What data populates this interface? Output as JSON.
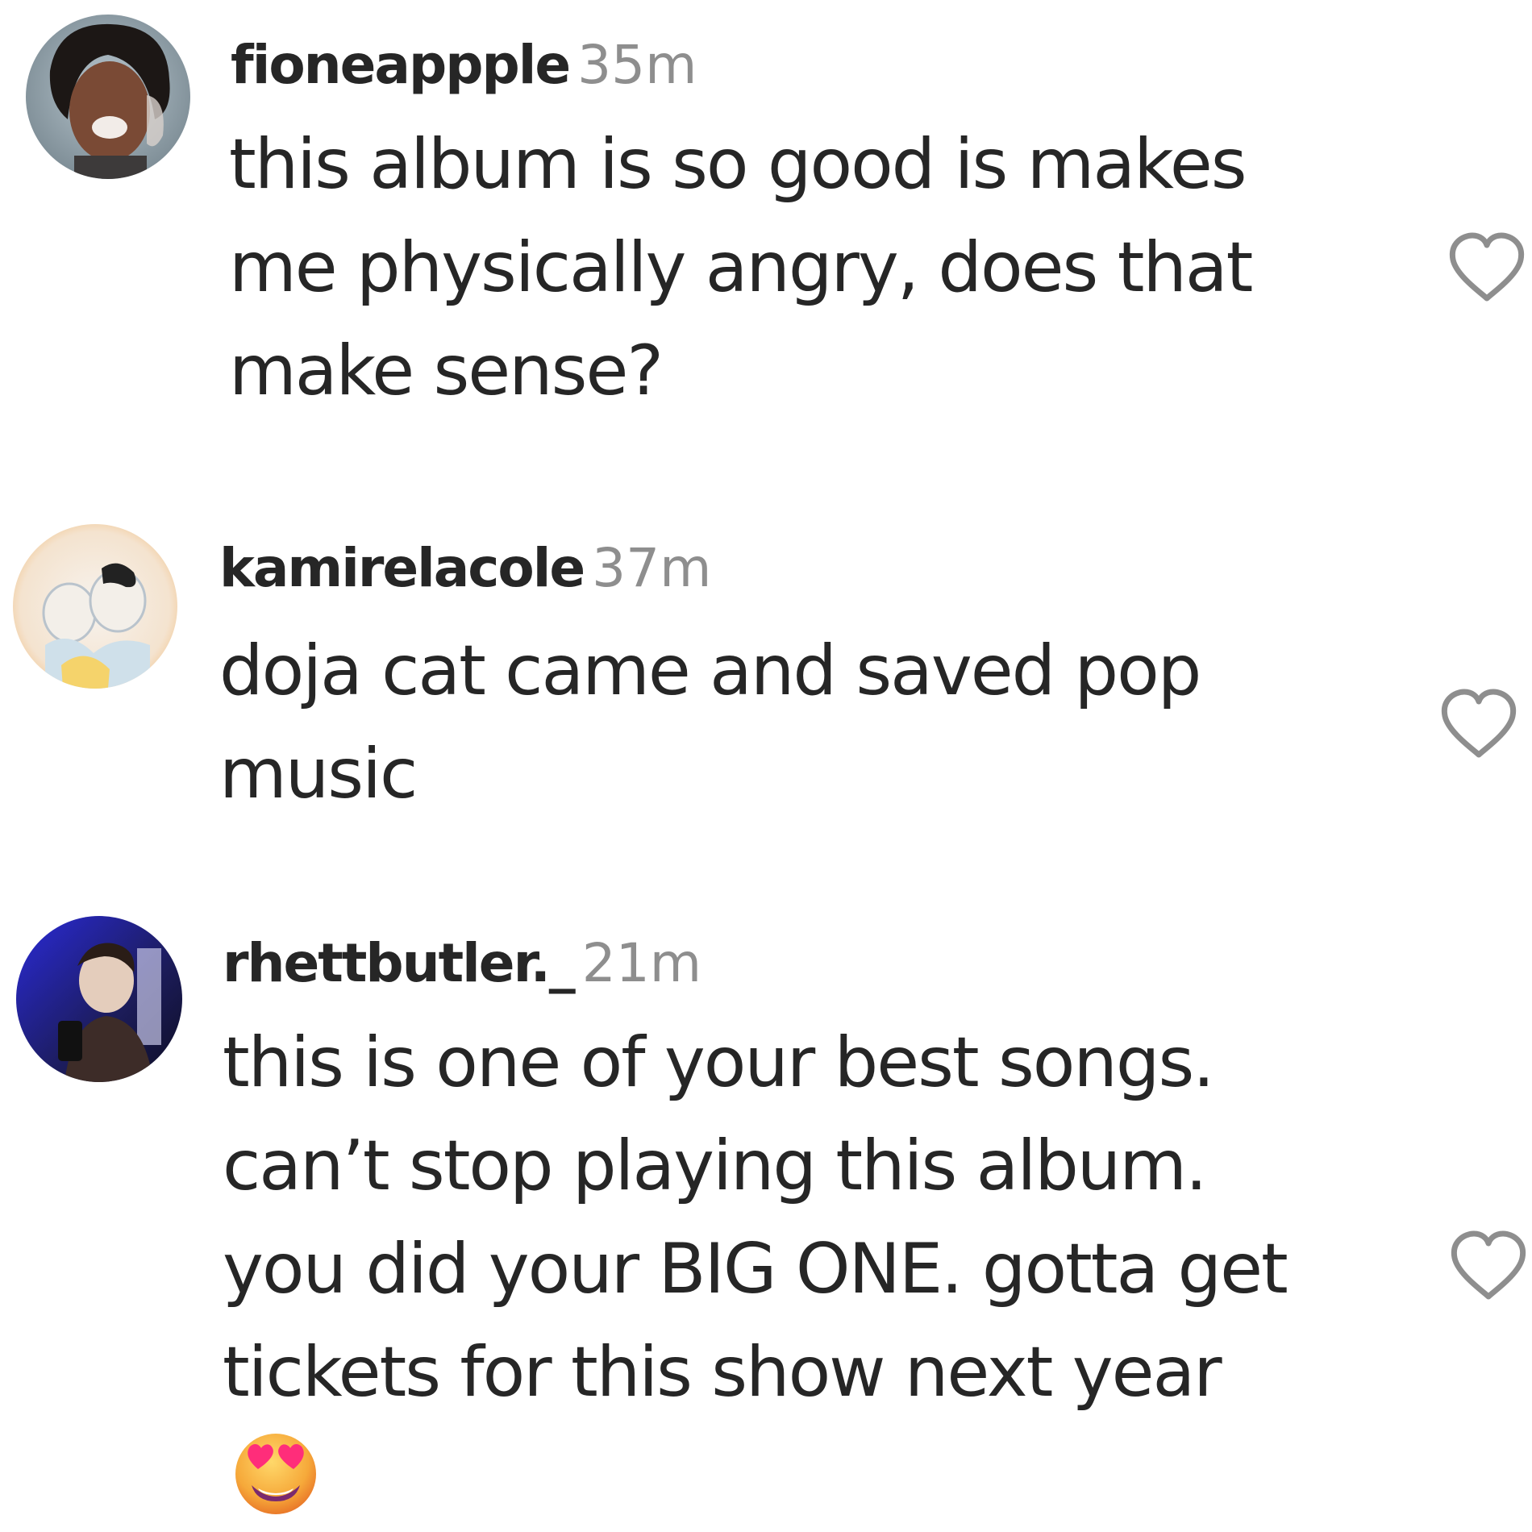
{
  "comments": [
    {
      "username": "fioneappple",
      "time": "35m",
      "lines": [
        "this album is so good is makes",
        "me physically angry, does that",
        "make sense?"
      ],
      "like_icon": "heart-outline-icon"
    },
    {
      "username": "kamirelacole",
      "time": "37m",
      "lines": [
        "doja cat came and saved pop",
        "music"
      ],
      "like_icon": "heart-outline-icon"
    },
    {
      "username": "rhettbutler._",
      "time": "21m",
      "lines": [
        "this is one of your best songs.",
        "can’t stop playing this album.",
        "you did your BIG ONE. gotta get",
        "tickets for this show next year"
      ],
      "emoji": "smiling-face-with-heart-eyes",
      "like_icon": "heart-outline-icon"
    }
  ],
  "colors": {
    "text": "#262626",
    "timestamp": "#8e8e8e",
    "heart_stroke": "#8e8e8e"
  }
}
